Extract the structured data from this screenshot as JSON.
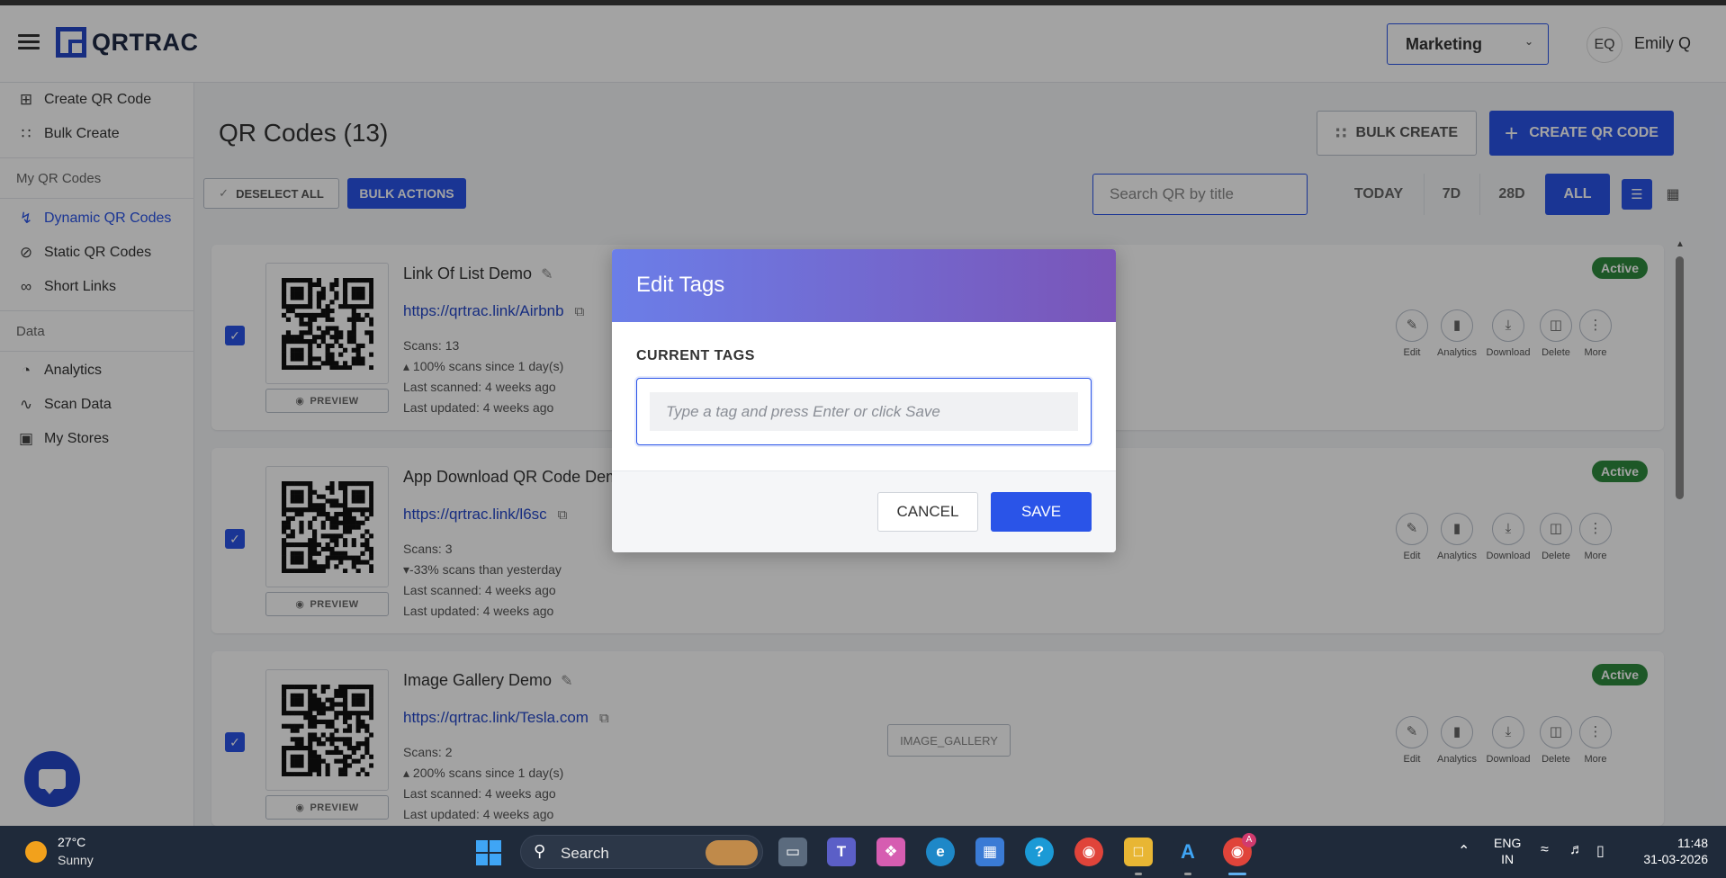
{
  "header": {
    "brand": "QRTRAC",
    "workspace": "Marketing",
    "user_initials": "EQ",
    "user_name": "Emily Q"
  },
  "sidebar": {
    "items_top": [
      {
        "label": "Create QR Code",
        "icon": "plus-square-icon"
      },
      {
        "label": "Bulk Create",
        "icon": "grid-dots-icon"
      }
    ],
    "section_my_qr": "My QR Codes",
    "items_qr": [
      {
        "label": "Dynamic QR Codes",
        "icon": "bolt-icon",
        "active": true
      },
      {
        "label": "Static QR Codes",
        "icon": "bolt-off-icon"
      },
      {
        "label": "Short Links",
        "icon": "link-icon"
      }
    ],
    "section_data": "Data",
    "items_data": [
      {
        "label": "Analytics",
        "icon": "pie-chart-icon"
      },
      {
        "label": "Scan Data",
        "icon": "activity-icon"
      },
      {
        "label": "My Stores",
        "icon": "store-bag-icon"
      }
    ]
  },
  "main": {
    "title": "QR Codes (13)",
    "bulk_create_label": "BULK CREATE",
    "create_label": "CREATE QR CODE",
    "deselect_label": "DESELECT ALL",
    "bulk_actions_label": "BULK ACTIONS",
    "search_placeholder": "Search QR by title",
    "ranges": [
      "TODAY",
      "7D",
      "28D",
      "ALL"
    ],
    "active_range": "ALL"
  },
  "cards": [
    {
      "title": "Link Of List Demo",
      "link": "https://qrtrac.link/Airbnb",
      "scans": "Scans: 13",
      "trend": "100% scans since 1 day(s)",
      "trend_dir": "up",
      "last_scanned": "Last scanned: 4 weeks ago",
      "last_updated": "Last updated: 4 weeks ago",
      "status": "Active",
      "tag": ""
    },
    {
      "title": "App Download QR Code Dem",
      "link": "https://qrtrac.link/l6sc",
      "scans": "Scans: 3",
      "trend": "-33% scans than yesterday",
      "trend_dir": "down",
      "last_scanned": "Last scanned: 4 weeks ago",
      "last_updated": "Last updated: 4 weeks ago",
      "status": "Active",
      "tag": ""
    },
    {
      "title": "Image Gallery Demo",
      "link": "https://qrtrac.link/Tesla.com",
      "scans": "Scans: 2",
      "trend": "200% scans since 1 day(s)",
      "trend_dir": "up",
      "last_scanned": "Last scanned: 4 weeks ago",
      "last_updated": "Last updated: 4 weeks ago",
      "status": "Active",
      "tag": "IMAGE_GALLERY"
    }
  ],
  "card_common": {
    "preview_label": "PREVIEW",
    "actions": [
      "Edit",
      "Analytics",
      "Download",
      "Delete",
      "More"
    ]
  },
  "modal": {
    "title": "Edit Tags",
    "section_label": "CURRENT TAGS",
    "input_placeholder": "Type a tag and press Enter or click Save",
    "cancel_label": "CANCEL",
    "save_label": "SAVE"
  },
  "taskbar": {
    "temperature": "27°C",
    "condition": "Sunny",
    "search_label": "Search",
    "lang_line1": "ENG",
    "lang_line2": "IN",
    "time": "11:48",
    "date": "31-03-2026",
    "badge": "A"
  },
  "colors": {
    "accent": "#2a54e8",
    "active_status": "#2e8a3e",
    "modal_gradient_start": "#6b7ee8",
    "modal_gradient_end": "#7a55b8"
  }
}
